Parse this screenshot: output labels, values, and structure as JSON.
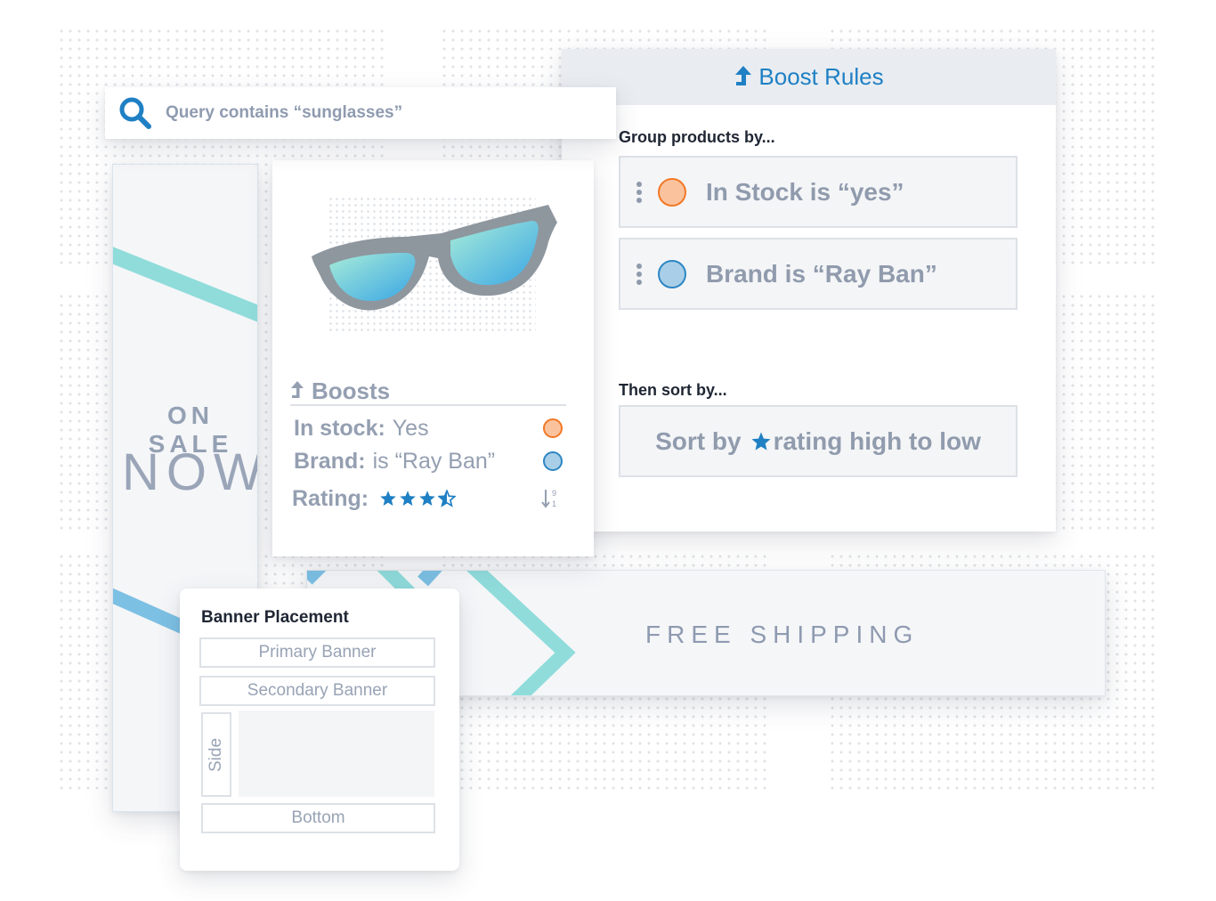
{
  "search": {
    "query_text": "Query contains “sunglasses”",
    "icon": "search-icon"
  },
  "sale_banner": {
    "line1": "ON SALE",
    "line2": "NOW"
  },
  "shipping_banner": {
    "text": "FREE SHIPPING"
  },
  "boost_rules": {
    "title": "Boost Rules",
    "title_icon": "boost-arrow-icon",
    "group_label": "Group products by...",
    "group_rules": [
      {
        "text": "In Stock is “yes”",
        "color": "orange"
      },
      {
        "text": "Brand is “Ray Ban”",
        "color": "blue"
      }
    ],
    "sort_label": "Then sort by...",
    "sort_rule": {
      "prefix": "Sort by",
      "suffix": "rating high to low",
      "icon": "star-icon"
    }
  },
  "product_card": {
    "image": "sunglasses-image",
    "boosts_title": "Boosts",
    "rows": [
      {
        "label": "In stock:",
        "value": "Yes"
      },
      {
        "label": "Brand:",
        "value": "is “Ray Ban”"
      },
      {
        "label": "Rating:",
        "value": ""
      }
    ],
    "rating_stars": 3.5,
    "sort_icon": {
      "top": "9",
      "bottom": "1"
    }
  },
  "banner_placement": {
    "title": "Banner Placement",
    "slots": {
      "primary": "Primary Banner",
      "secondary": "Secondary Banner",
      "side": "Side",
      "bottom": "Bottom"
    }
  },
  "colors": {
    "accent_blue": "#1f80c4",
    "orange": "#f27826",
    "teal": "#8fdcdb",
    "text_gray": "#909bad"
  }
}
